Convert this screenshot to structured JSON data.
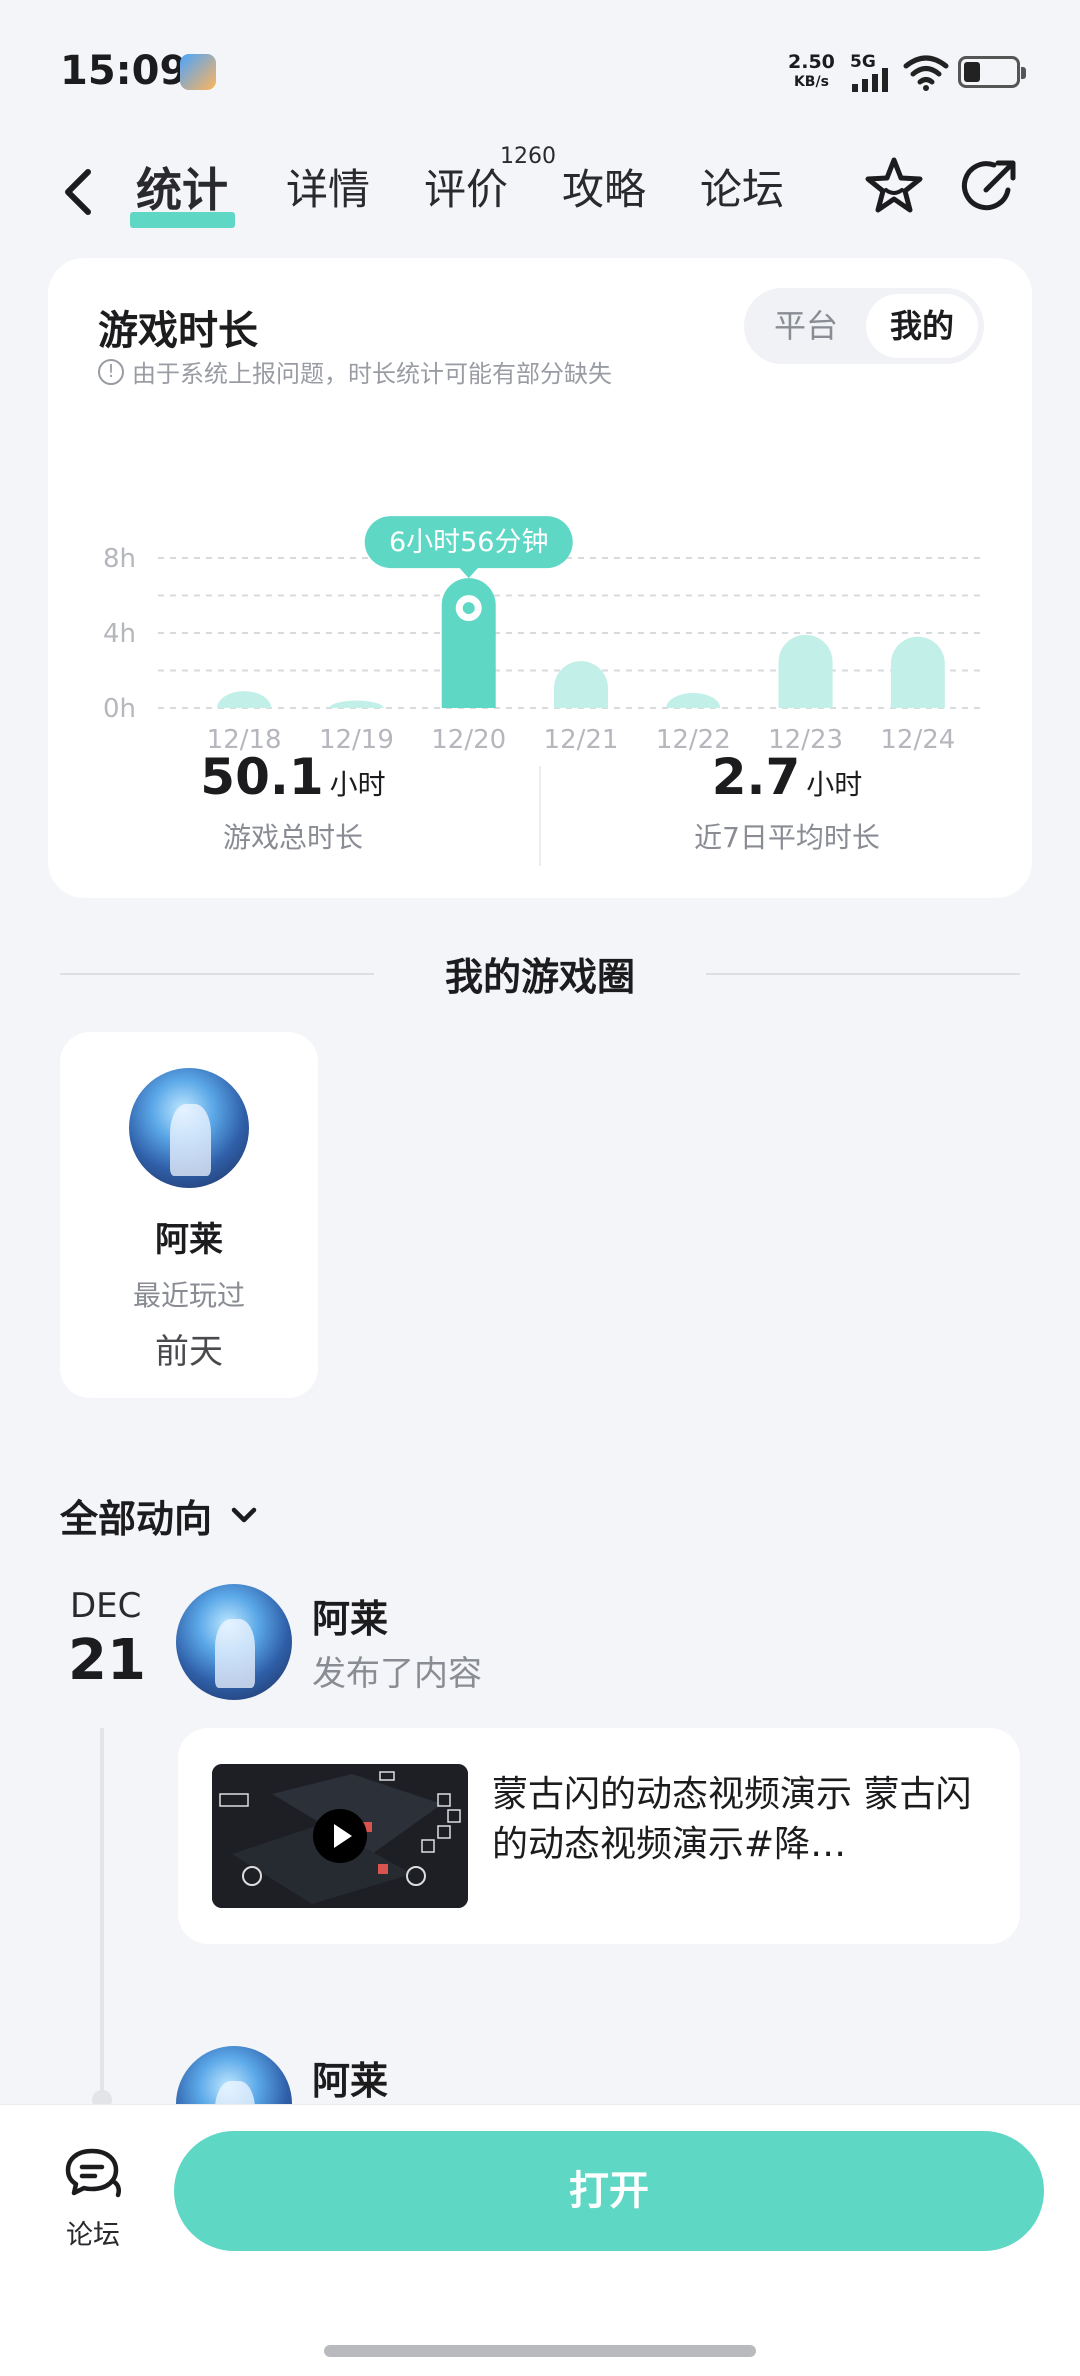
{
  "status_bar": {
    "time": "15:09",
    "net_speed": "2.50",
    "net_unit": "KB/s",
    "network": "5G"
  },
  "nav": {
    "tabs": [
      {
        "label": "统计",
        "active": true
      },
      {
        "label": "详情"
      },
      {
        "label": "评价"
      },
      {
        "label": "攻略"
      },
      {
        "label": "论坛"
      }
    ],
    "review_count": "1260"
  },
  "playtime": {
    "title": "游戏时长",
    "note": "由于系统上报问题，时长统计可能有部分缺失",
    "toggle": {
      "platform": "平台",
      "mine": "我的",
      "selected": "mine"
    },
    "tooltip": "6小时56分钟",
    "total": {
      "value": "50.1",
      "unit": "小时",
      "label": "游戏总时长"
    },
    "average": {
      "value": "2.7",
      "unit": "小时",
      "label": "近7日平均时长"
    }
  },
  "chart_data": {
    "type": "bar",
    "categories": [
      "12/18",
      "12/19",
      "12/20",
      "12/21",
      "12/22",
      "12/23",
      "12/24"
    ],
    "values": [
      0.9,
      0.4,
      6.93,
      2.5,
      0.8,
      3.9,
      3.8
    ],
    "highlight_index": 2,
    "yticks": [
      "0h",
      "4h",
      "8h"
    ],
    "ylim": [
      0,
      8
    ],
    "grid": true,
    "colors": {
      "bar": "#c2f0e9",
      "highlight": "#5fd7c5"
    }
  },
  "game_circle": {
    "title": "我的游戏圈",
    "friends": [
      {
        "name": "阿莱",
        "subtitle": "最近玩过",
        "when": "前天"
      }
    ]
  },
  "feed": {
    "filter": "全部动向",
    "month": "DEC",
    "day": "21",
    "posts": [
      {
        "author": "阿莱",
        "action": "发布了内容",
        "text": "蒙古闪的动态视频演示 蒙古闪的动态视频演示#降…"
      },
      {
        "author": "阿莱"
      }
    ]
  },
  "bottom": {
    "forum_label": "论坛",
    "open_label": "打开"
  }
}
